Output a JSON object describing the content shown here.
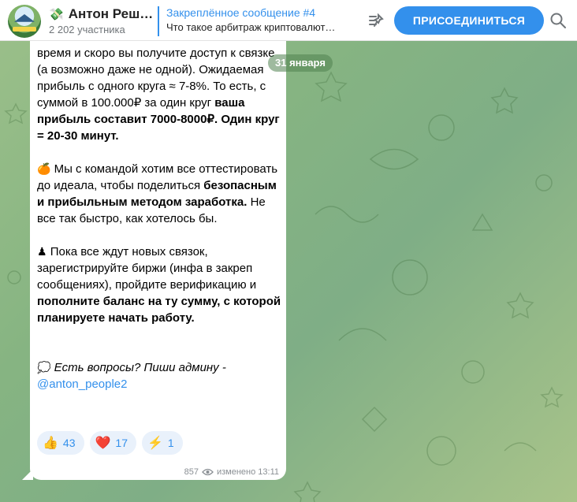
{
  "header": {
    "title": "Антон Реш…",
    "subtitle": "2 202 участника",
    "title_icon": "money-icon"
  },
  "pinned": {
    "title": "Закреплённое сообщение #4",
    "text": "Что такое арбитраж криптовалют…"
  },
  "actions": {
    "join_label": "ПРИСОЕДИНИТЬСЯ"
  },
  "date_chip": "31 января",
  "message": {
    "p1_a": "время и скоро вы получите доступ к связке (а возможно даже не одной). Ожидаемая прибыль с одного круга ≈ 7-8%. То есть, с суммой в 100.000₽ за один круг ",
    "p1_b": "ваша прибыль составит 7000-8000₽. Один круг = 20-30 минут.",
    "p2_emoji": "🍊",
    "p2_a": "Мы с командой хотим все оттестировать до идеала, чтобы поделиться ",
    "p2_b": "безопасным и прибыльным методом заработка.",
    "p2_c": " Не все так быстро, как хотелось бы.",
    "p3_emoji": "♟",
    "p3_a": "Пока все ждут новых связок, зарегистрируйте биржи (инфа в закреп сообщениях), пройдите верификацию и ",
    "p3_b": "пополните баланс на ту сумму, с которой планируете начать работу.",
    "p4_emoji": "💭",
    "p4_text": "Есть вопросы? Пиши админу - ",
    "p4_link": "@anton_people2"
  },
  "reactions": [
    {
      "icon": "👍",
      "count": "43"
    },
    {
      "icon": "❤️",
      "count": "17"
    },
    {
      "icon": "⚡",
      "count": "1"
    }
  ],
  "meta": {
    "views": "857",
    "edited": "изменено 13:11"
  }
}
